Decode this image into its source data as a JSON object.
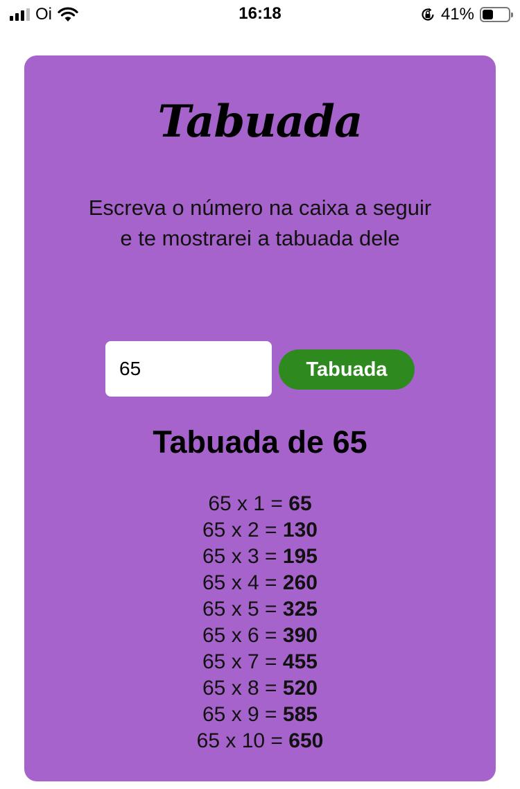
{
  "status_bar": {
    "carrier": "Oi",
    "time": "16:18",
    "battery_percent": "41%",
    "battery_level": 0.41,
    "icons": [
      "signal-icon",
      "wifi-icon",
      "orientation-lock-icon",
      "battery-icon"
    ]
  },
  "app": {
    "title": "Tabuada",
    "description": "Escreva o número na caixa a seguir e te mostrarei a tabuada dele",
    "input_value": "65",
    "button_label": "Tabuada",
    "result_title": "Tabuada de 65",
    "colors": {
      "card_background": "#a763cc",
      "button_background": "#2e8a1f"
    },
    "rows": [
      {
        "expr": "65 x 1 = ",
        "result": "65"
      },
      {
        "expr": "65 x 2 = ",
        "result": "130"
      },
      {
        "expr": "65 x 3 = ",
        "result": "195"
      },
      {
        "expr": "65 x 4 = ",
        "result": "260"
      },
      {
        "expr": "65 x 5 = ",
        "result": "325"
      },
      {
        "expr": "65 x 6 = ",
        "result": "390"
      },
      {
        "expr": "65 x 7 = ",
        "result": "455"
      },
      {
        "expr": "65 x 8 = ",
        "result": "520"
      },
      {
        "expr": "65 x 9 = ",
        "result": "585"
      },
      {
        "expr": "65 x 10 = ",
        "result": "650"
      }
    ]
  }
}
